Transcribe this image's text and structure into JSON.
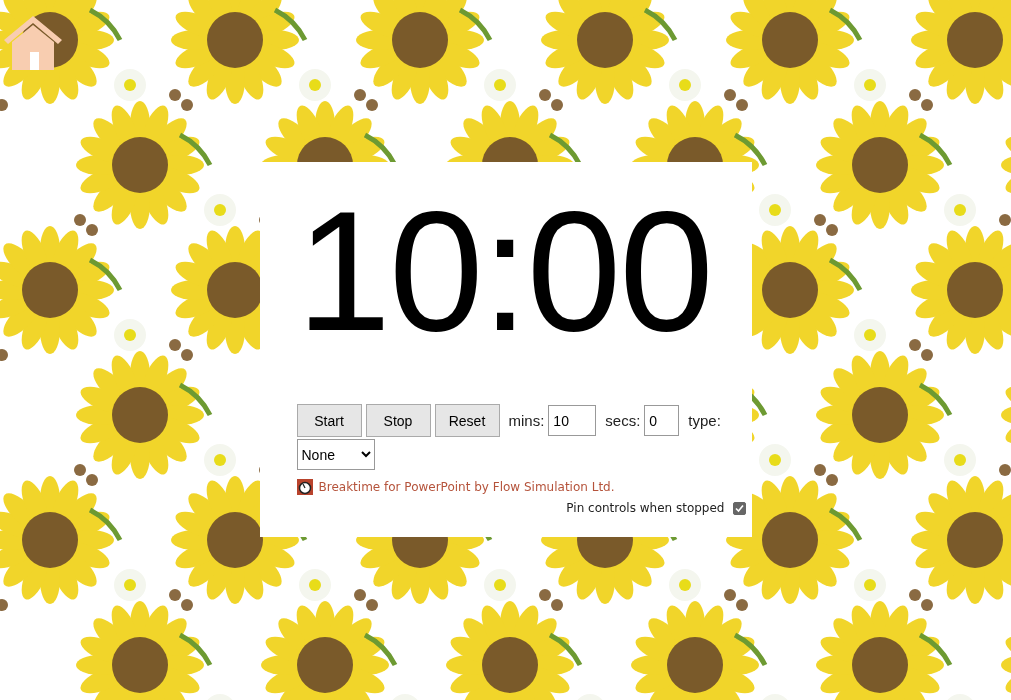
{
  "timer": {
    "display": "10:00"
  },
  "controls": {
    "buttons": [
      {
        "label": "Start"
      },
      {
        "label": "Stop"
      },
      {
        "label": "Reset"
      }
    ],
    "mins": {
      "label": "mins:",
      "value": "10"
    },
    "secs": {
      "label": "secs:",
      "value": "0"
    },
    "type": {
      "label": "type:",
      "value": "None"
    }
  },
  "credit": {
    "text": "Breaktime for PowerPoint by Flow Simulation Ltd."
  },
  "pin": {
    "label": "Pin controls when stopped",
    "checked": true
  }
}
